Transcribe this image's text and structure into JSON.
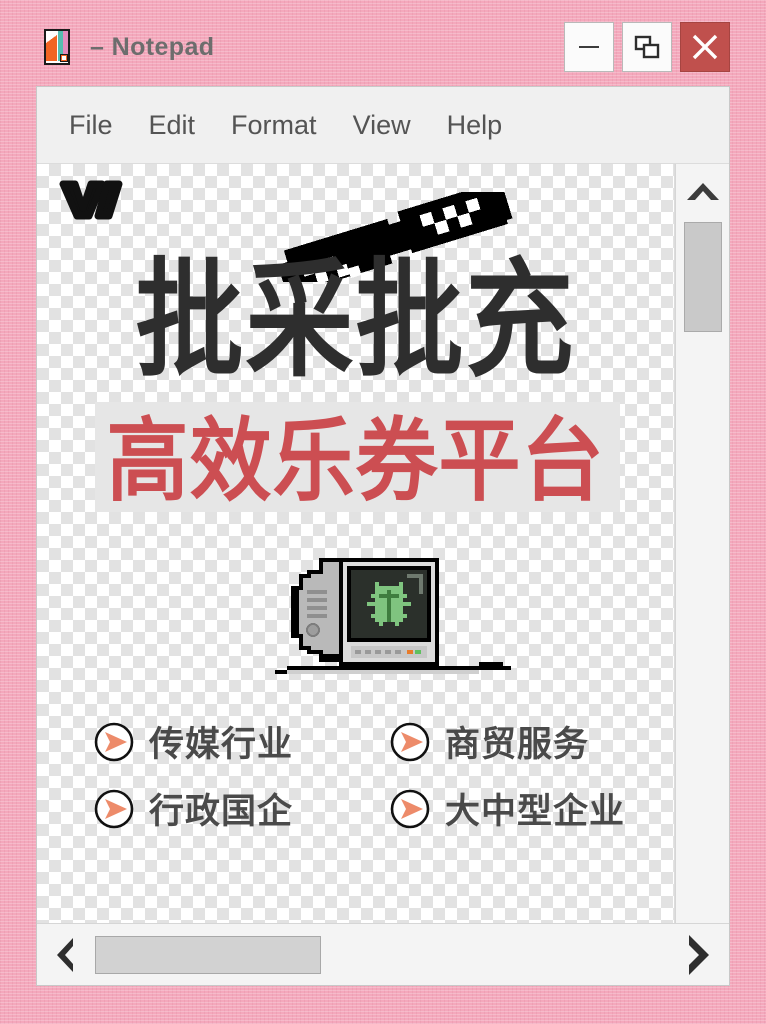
{
  "window": {
    "title": "– Notepad",
    "app_icon": "notepad-document-icon",
    "controls": [
      {
        "name": "minimize",
        "glyph": "minimize-icon"
      },
      {
        "name": "restore",
        "glyph": "restore-icon"
      },
      {
        "name": "close",
        "glyph": "close-icon",
        "color": "#c0504d"
      }
    ]
  },
  "menu": {
    "items": [
      {
        "label": "File"
      },
      {
        "label": "Edit"
      },
      {
        "label": "Format"
      },
      {
        "label": "View"
      },
      {
        "label": "Help"
      }
    ]
  },
  "canvas": {
    "background": "transparency-checkerboard",
    "brand_logo": "w-mark-logo",
    "sunglasses": "pixel-sunglasses-icon",
    "headline": "批采批充",
    "headline_color": "#2e2e2e",
    "subheadline": "高效乐券平台",
    "subheadline_color": "#cc4e52",
    "illustration": "retro-crt-computer-with-bug-icon",
    "bullets": [
      {
        "label": "传媒行业",
        "icon": "play-arrow-circle-icon"
      },
      {
        "label": "商贸服务",
        "icon": "play-arrow-circle-icon"
      },
      {
        "label": "行政国企",
        "icon": "play-arrow-circle-icon"
      },
      {
        "label": "大中型企业",
        "icon": "play-arrow-circle-icon"
      }
    ],
    "bullet_icon_color": "#ed8b6a"
  },
  "scrollbars": {
    "vertical": {
      "up_arrow": "chevron-up-icon",
      "thumb_position_percent": 4
    },
    "horizontal": {
      "left_arrow": "chevron-left-icon",
      "right_arrow": "chevron-right-icon",
      "thumb_position_percent": 3
    }
  },
  "desktop": {
    "background_color": "#f4a8bc"
  }
}
